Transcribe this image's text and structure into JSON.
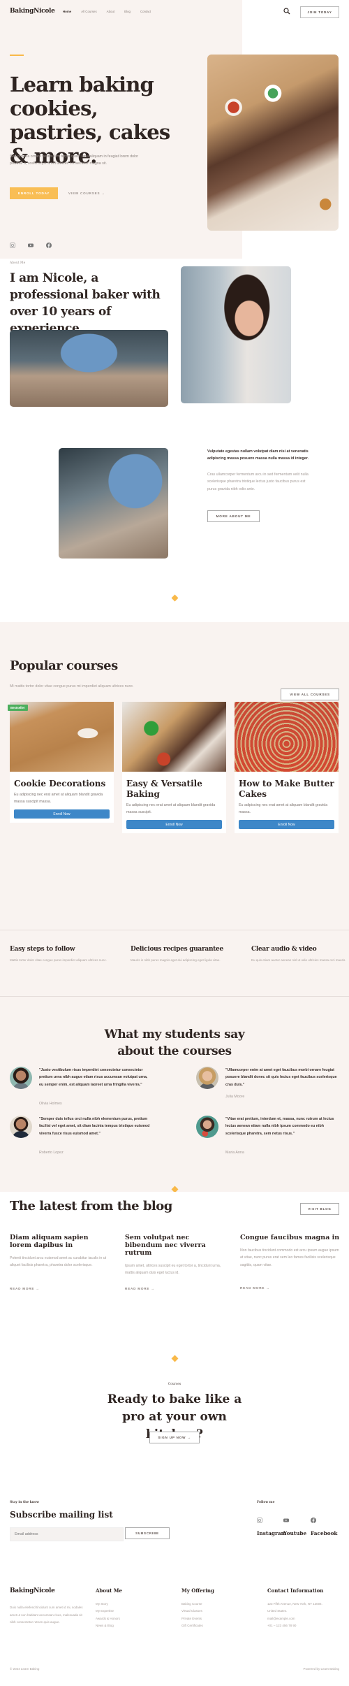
{
  "header": {
    "logo": "BakingNicole",
    "nav": [
      "Home",
      "All Courses",
      "About",
      "Blog",
      "Contact"
    ],
    "join_label": "JOIN TODAY",
    "search_icon": "search-icon"
  },
  "hero": {
    "title": "Learn baking cookies, pastries, cakes & more.",
    "text": "Sed gravida ornare vestibulum turpis quam urna aliquam in feugiat lorem dolor pulvinar a, scelerisque amet ultrices consectetur magna sit.",
    "enroll_label": "ENROLL TODAY",
    "view_courses_label": "VIEW COURSES →",
    "social_icons": [
      "instagram-icon",
      "youtube-icon",
      "facebook-icon"
    ]
  },
  "about": {
    "label": "About Me",
    "title": "I am Nicole, a professional baker with over 10 years of experience",
    "bold_text": "Vulputate egestas nullam volutpat diam nisi at venenatis adipiscing massa posuere massa nulla massa id integer.",
    "text": "Cras ullamcorper fermentum arcu in sed fermentum velit nulla scelerisque pharetra tristique lectus justo faucibus purus est purus gravida nibh odio ante.",
    "button_label": "MORE ABOUT ME"
  },
  "courses": {
    "title": "Popular courses",
    "subtitle": "Mi mattis tortor dolor vitae congue purus mi imperdiet aliquam ultrices nunc.",
    "view_all_label": "VIEW ALL COURSES",
    "items": [
      {
        "title": "Cookie Decorations",
        "text": "Eu adipiscing nec erat amet at aliquam blandit gravida massa suscipit massa.",
        "button": "Enroll Now",
        "badge": "Bestseller"
      },
      {
        "title": "Easy & Versatile Baking",
        "text": "Eu adipiscing nec erat amet at aliquam blandit gravida massa suscipit.",
        "button": "Enroll Now"
      },
      {
        "title": "How to Make Butter Cakes",
        "text": "Eu adipiscing nec erat amet at aliquam blandit gravida massa.",
        "button": "Enroll Now"
      }
    ]
  },
  "features": [
    {
      "title": "Easy steps to follow",
      "text": "Mattis tortor dolor vitae congue purus imperdiet aliquam ultrices nunc."
    },
    {
      "title": "Delicious recipes guarantee",
      "text": "Mauris in nibh purus magnis eget dui adipiscing eget ligula vitae."
    },
    {
      "title": "Clear audio & video",
      "text": "Eu quis etiam auctor aenean nisl ut odio ultricies massa orci mauris."
    }
  ],
  "testimonials": {
    "title": "What my students say about the courses",
    "items": [
      {
        "quote": "\"Justo vestibulum risus imperdiet consectetur consectetur pretium urna nibh augue etiam risus accumsan volutpat urna, eu semper enim, est aliquam laoreet urna fringilla viverra.\"",
        "name": "Olivia Holmes"
      },
      {
        "quote": "\"Ullamcorper enim at amet eget faucibus morbi ornare feugiat posuere blandit donec sit quis lectus eget faucibus scelerisque cras duis.\"",
        "name": "Julia Moore"
      },
      {
        "quote": "\"Semper duis tellus orci nulla nibh elementum purus, pretium facilisi vel eget amet, sit diam lacinia tempus tristique euismod viverra fusce risus euismod amet.\"",
        "name": "Roberto Lopez"
      },
      {
        "quote": "\"Vitae erat pretium, interdum et, massa, nunc rutrum at lectus lectus aenean etiam nulla nibh ipsum commodo eu nibh scelerisque pharetra, sem netus risus.\"",
        "name": "Maria Anna"
      }
    ]
  },
  "blog": {
    "title": "The latest from the blog",
    "visit_label": "VISIT BLOG",
    "posts": [
      {
        "title": "Diam aliquam sapien lorem dapibus in",
        "text": "Potenti tincidunt arcu euismod amet ac curabitur iaculis in ut aliquet facilisis pharetra, pharetra dolor scelerisque.",
        "more": "READ MORE →"
      },
      {
        "title": "Sem volutpat nec bibendum nec viverra rutrum",
        "text": "Ipsum amet, ultrices suscipit eu eget tortor a, tincidunt urna, mattis aliquam duis eget luctus id.",
        "more": "READ MORE →"
      },
      {
        "title": "Congue faucibus magna in",
        "text": "Non faucibus tincidunt commodo est arcu ipsum augue ipsum at vitae, nunc purus erat sem leo fames facilisis scelerisque sagittis, quam vitae.",
        "more": "READ MORE →"
      }
    ]
  },
  "cta": {
    "label": "Courses",
    "title": "Ready to bake like a pro at your own kitchen?",
    "button_label": "SIGN UP NOW →"
  },
  "subscribe": {
    "label": "Stay in the know",
    "title": "Subscribe mailing list",
    "email_placeholder": "Email address",
    "button_label": "SUBSCRIBE",
    "follow_label": "Follow me",
    "follow": [
      "Instagram",
      "Youtube",
      "Facebook"
    ]
  },
  "footer": {
    "logo": "BakingNicole",
    "about": "Duis nulla eleifend tincidunt cum amet id mi, sodales amet ut non habitant accumsan risus, malesuada sit nibh consectetur rutrum quis augue.",
    "columns": [
      {
        "title": "About Me",
        "links": [
          "My Story",
          "My Expertise",
          "Awards & Honors",
          "News & Blog"
        ]
      },
      {
        "title": "My Offering",
        "links": [
          "Baking Course",
          "Virtual Classes",
          "Private Events",
          "Gift Certificates"
        ]
      },
      {
        "title": "Contact Information",
        "links": [
          "123 Fifth Avenue, New York, NY 12004.",
          "United States.",
          "mail@example.com",
          "+01 – 123 456 78 90"
        ]
      }
    ],
    "copyright": "© 2024 Learn Baking",
    "powered": "Powered by Learn Baking"
  },
  "colors": {
    "accent": "#f9b949",
    "enroll_button": "#3d87c8",
    "badge": "#4cae5d",
    "cream": "#f9f3f0",
    "text": "#2f2522"
  }
}
